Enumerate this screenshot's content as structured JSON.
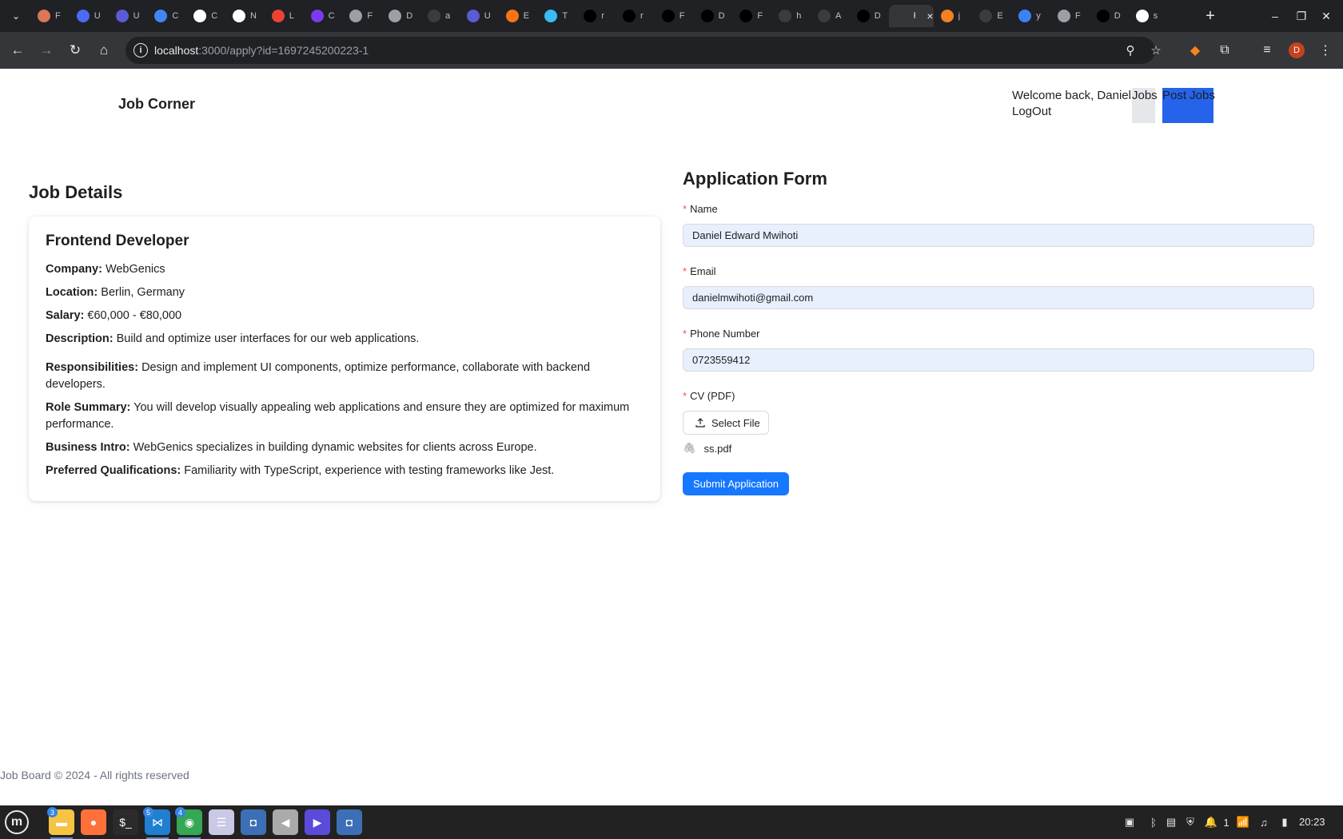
{
  "browser": {
    "tabs": [
      {
        "initial": "F",
        "icon": "claude-icon",
        "color": "#d97757"
      },
      {
        "initial": "U",
        "icon": "target-icon",
        "color": "#4a6cf7"
      },
      {
        "initial": "U",
        "icon": "circle-icon",
        "color": "#5b5bd6"
      },
      {
        "initial": "C",
        "icon": "sparkle-icon",
        "color": "#4285f4"
      },
      {
        "initial": "C",
        "icon": "openai-icon",
        "color": "#ffffff"
      },
      {
        "initial": "N",
        "icon": "openai-icon",
        "color": "#ffffff"
      },
      {
        "initial": "L",
        "icon": "gmail-icon",
        "color": "#ea4335"
      },
      {
        "initial": "C",
        "icon": "list-icon",
        "color": "#7c3aed"
      },
      {
        "initial": "F",
        "icon": "globe-icon",
        "color": "#9aa0a6"
      },
      {
        "initial": "D",
        "icon": "triangle-icon",
        "color": "#9aa0a6"
      },
      {
        "initial": "a",
        "icon": "github-icon",
        "color": "#3c3c3c"
      },
      {
        "initial": "U",
        "icon": "circle-icon",
        "color": "#5b5bd6"
      },
      {
        "initial": "E",
        "icon": "shield-icon",
        "color": "#f97316"
      },
      {
        "initial": "T",
        "icon": "wave-icon",
        "color": "#38bdf8"
      },
      {
        "initial": "r",
        "icon": "vercel-icon",
        "color": "#000000"
      },
      {
        "initial": "r",
        "icon": "vercel-icon",
        "color": "#000000"
      },
      {
        "initial": "F",
        "icon": "next-icon",
        "color": "#000000"
      },
      {
        "initial": "D",
        "icon": "next-icon",
        "color": "#000000"
      },
      {
        "initial": "F",
        "icon": "next-icon",
        "color": "#000000"
      },
      {
        "initial": "h",
        "icon": "github-icon",
        "color": "#3c3c3c"
      },
      {
        "initial": "A",
        "icon": "globe-icon",
        "color": "#3c3c3c"
      },
      {
        "initial": "D",
        "icon": "next-icon",
        "color": "#000000"
      },
      {
        "initial": "F",
        "icon": "page-icon",
        "color": "#35363a",
        "active": true
      },
      {
        "initial": "j",
        "icon": "stackoverflow-icon",
        "color": "#f48024"
      },
      {
        "initial": "E",
        "icon": "github-icon",
        "color": "#3c3c3c"
      },
      {
        "initial": "y",
        "icon": "drop-icon",
        "color": "#3b82f6"
      },
      {
        "initial": "F",
        "icon": "globe-icon",
        "color": "#9aa0a6"
      },
      {
        "initial": "D",
        "icon": "next-icon",
        "color": "#000000"
      },
      {
        "initial": "s",
        "icon": "stripe-icon",
        "color": "#ffffff"
      }
    ],
    "url_host": "localhost",
    "url_rest": ":3000/apply?id=1697245200223-1",
    "profile_initial": "D"
  },
  "header": {
    "brand": "Job Corner",
    "welcome": "Welcome back, Daniel",
    "jobs_link": "Jobs",
    "post_jobs_link": "Post Jobs",
    "logout_link": "LogOut"
  },
  "job": {
    "heading": "Job Details",
    "title": "Frontend Developer",
    "rows": [
      {
        "label": "Company:",
        "value": "WebGenics"
      },
      {
        "label": "Location:",
        "value": "Berlin, Germany"
      },
      {
        "label": "Salary:",
        "value": "€60,000 - €80,000"
      },
      {
        "label": "Description:",
        "value": "Build and optimize user interfaces for our web applications."
      },
      {
        "label": "Responsibilities:",
        "value": "Design and implement UI components, optimize performance, collaborate with backend developers."
      },
      {
        "label": "Role Summary:",
        "value": "You will develop visually appealing web applications and ensure they are optimized for maximum performance."
      },
      {
        "label": "Business Intro:",
        "value": "WebGenics specializes in building dynamic websites for clients across Europe."
      },
      {
        "label": "Preferred Qualifications:",
        "value": "Familiarity with TypeScript, experience with testing frameworks like Jest."
      }
    ]
  },
  "form": {
    "heading": "Application Form",
    "required_mark": "*",
    "name_label": "Name",
    "name_value": "Daniel Edward Mwihoti",
    "email_label": "Email",
    "email_value": "danielmwihoti@gmail.com",
    "phone_label": "Phone Number",
    "phone_value": "0723559412",
    "cv_label": "CV (PDF)",
    "select_file_label": "Select File",
    "file_name": "ss.pdf",
    "submit_label": "Submit Application"
  },
  "footer": {
    "text": "Job Board © 2024 - All rights reserved"
  },
  "taskbar": {
    "apps": [
      {
        "name": "files",
        "icon": "folder-icon",
        "color": "#f6c343",
        "badge": "3"
      },
      {
        "name": "firefox",
        "icon": "firefox-icon",
        "color": "#ff7139"
      },
      {
        "name": "terminal",
        "icon": "terminal-icon",
        "color": "#2b2b2b"
      },
      {
        "name": "vscode",
        "icon": "vscode-icon",
        "color": "#1f7fd1",
        "badge": "5"
      },
      {
        "name": "chrome",
        "icon": "chrome-icon",
        "color": "#34a853",
        "badge": "4"
      },
      {
        "name": "text-editor",
        "icon": "notepad-icon",
        "color": "#c9c9e6"
      },
      {
        "name": "screenshot",
        "icon": "camera-icon",
        "color": "#3d6fb6"
      },
      {
        "name": "sound",
        "icon": "speaker-icon",
        "color": "#aaaaaa"
      },
      {
        "name": "media-player",
        "icon": "play-icon",
        "color": "#5b4bdb"
      },
      {
        "name": "screenshot-2",
        "icon": "camera-icon",
        "color": "#3d6fb6"
      }
    ],
    "workspace_count": "1",
    "clock": "20:23"
  }
}
